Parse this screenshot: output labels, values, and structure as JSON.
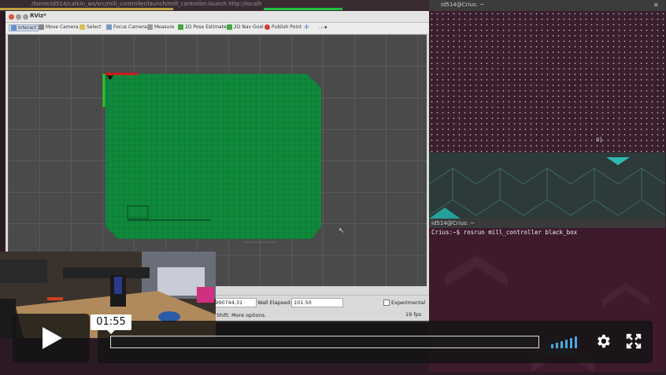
{
  "desktop": {
    "path_text": "/home/id514/catkin_ws/src/mill_controller/launch/mill_controller.launch http://localh",
    "term1_title": "id514@Crius: ~",
    "term1_output": "0]",
    "term2_title": "id514@Crius: ~",
    "term2_command": "Crius:~$ rosrun mill_controller black_box"
  },
  "rviz": {
    "title": "RViz*",
    "toolbar": [
      {
        "label": "Interact",
        "icon": "cursor-icon",
        "color": "#6a8fd0"
      },
      {
        "label": "Move Camera",
        "icon": "camera-icon",
        "color": "#888888"
      },
      {
        "label": "Select",
        "icon": "select-box-icon",
        "color": "#d6c25a"
      },
      {
        "label": "Focus Camera",
        "icon": "focus-icon",
        "color": "#7a9ac0"
      },
      {
        "label": "Measure",
        "icon": "ruler-icon",
        "color": "#9a9a9a"
      },
      {
        "label": "2D Pose Estimate",
        "icon": "pose-arrow-icon",
        "color": "#46a846"
      },
      {
        "label": "2D Nav Goal",
        "icon": "goal-arrow-icon",
        "color": "#46a846"
      },
      {
        "label": "Publish Point",
        "icon": "pin-icon",
        "color": "#d04040"
      }
    ],
    "status": {
      "ros_elapsed": "990744.31",
      "wall_elapsed_label": "Wall Elapsed:",
      "wall_elapsed": "101.50",
      "experimental_label": "Experimental",
      "hint": "Shift: More options.",
      "fps": "19 fps"
    },
    "colors": {
      "grid_map": "#0f8a3c",
      "axis_x": "#d01818",
      "axis_y": "#22d022"
    }
  },
  "player": {
    "current_time": "01:55",
    "progress": 0.0,
    "accent": "#4aa8e0"
  }
}
